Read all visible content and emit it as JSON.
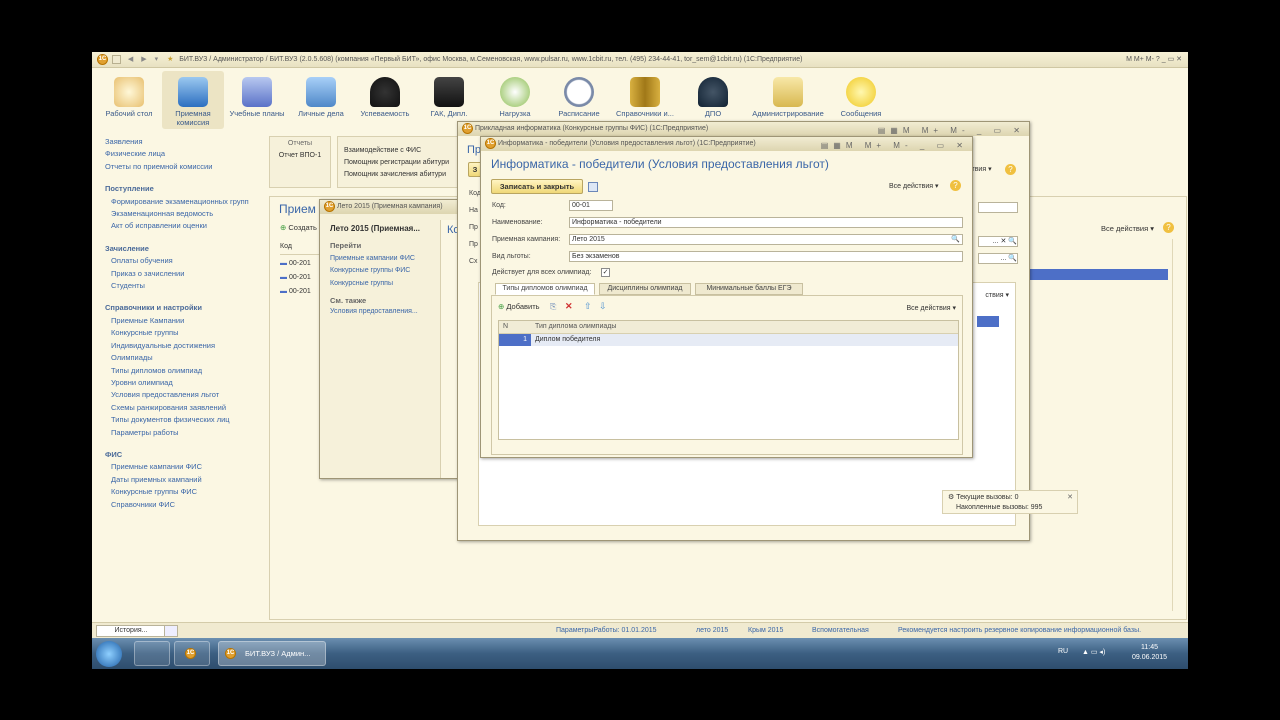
{
  "app": {
    "title": "БИТ.ВУЗ / Администратор / БИТ.ВУЗ (2.0.5.608) (компания «Первый БИТ», офис Москва, м.Семеновская, www.pulsar.ru, www.1cbit.ru, тел. (495) 234-44-41, tor_sem@1cbit.ru)  (1С:Предприятие)",
    "title_buttons": "M  M+  M-"
  },
  "toolbar": {
    "items": [
      {
        "label": "Рабочий стол",
        "icon": "desktop-icon"
      },
      {
        "label": "Приемная комиссия",
        "icon": "building-icon"
      },
      {
        "label": "Учебные планы",
        "icon": "planner-icon"
      },
      {
        "label": "Личные дела",
        "icon": "folder-icon"
      },
      {
        "label": "Успеваемость",
        "icon": "person-icon"
      },
      {
        "label": "ГАК, Дипл.",
        "icon": "graduation-cap-icon"
      },
      {
        "label": "Нагрузка",
        "icon": "globe-icon"
      },
      {
        "label": "Расписание",
        "icon": "clock-icon"
      },
      {
        "label": "Справочники и...",
        "icon": "books-icon"
      },
      {
        "label": "ДПО",
        "icon": "graduate-icon"
      },
      {
        "label": "Администрирование",
        "icon": "admin-icon"
      },
      {
        "label": "Сообщения",
        "icon": "message-icon"
      }
    ]
  },
  "leftnav": {
    "top": [
      "Заявления",
      "Физические лица",
      "Отчеты по приемной комиссии"
    ],
    "groups": [
      {
        "title": "Поступление",
        "items": [
          "Формирование экзаменационных групп",
          "Экзаменационная ведомость",
          "Акт об исправлении оценки"
        ]
      },
      {
        "title": "Зачисление",
        "items": [
          "Оплаты обучения",
          "Приказ о зачислении",
          "Студенты"
        ]
      },
      {
        "title": "Справочники и настройки",
        "items": [
          "Приемные Кампании",
          "Конкурсные группы",
          "Индивидуальные достижения",
          "Олимпиады",
          "Типы дипломов олимпиад",
          "Уровни олимпиад",
          "Условия предоставления льгот",
          "Схемы ранжирования заявлений",
          "Типы документов физических лиц",
          "Параметры работы"
        ]
      },
      {
        "title": "ФИС",
        "items": [
          "Приемные кампании ФИС",
          "Даты приемных кампаний",
          "Конкурсные группы ФИС",
          "Справочники ФИС"
        ]
      }
    ]
  },
  "background": {
    "reports_label": "Отчеты",
    "report_item": "Отчет ВПО-1",
    "fis_items": [
      "Взаимодействие с ФИС",
      "Помощник регистрации абитури",
      "Помощник зачисления абитури"
    ],
    "list_title": "Прием",
    "create_btn": "Создать",
    "col_code": "Код",
    "rows": [
      "00-201",
      "00-201",
      "00-201"
    ],
    "all_actions": "Все действия"
  },
  "leto_window": {
    "title": "Лето 2015 (Приемная кампания)",
    "header": "Лето 2015 (Приемная...",
    "goto": "Перейти",
    "goto_items": [
      "Приемные кампании ФИС",
      "Конкурсные группы ФИС",
      "Конкурсные группы"
    ],
    "see_also": "См. также",
    "see_also_items": [
      "Условия предоставления..."
    ]
  },
  "app_info_window": {
    "title": "Прикладная информатика (Конкурсные группы ФИС)  (1С:Предприятие)",
    "fields": [
      "Код",
      "На",
      "Пр",
      "Пр",
      "Сх"
    ]
  },
  "dialog": {
    "window_title": "Информатика - победители (Условия предоставления льгот)  (1С:Предприятие)",
    "heading": "Информатика - победители (Условия предоставления льгот)",
    "save_button": "Записать и закрыть",
    "all_actions": "Все действия",
    "form": {
      "code_label": "Код:",
      "code_value": "00-01",
      "name_label": "Наименование:",
      "name_value": "Информатика - победители",
      "campaign_label": "Приемная кампания:",
      "campaign_value": "Лето 2015",
      "benefit_label": "Вид льготы:",
      "benefit_value": "Без экзаменов",
      "all_olympiads_label": "Действует для всех олимпиад:",
      "all_olympiads_checked": true
    },
    "tabs": [
      "Типы дипломов олимпиад",
      "Дисциплины олимпиад",
      "Минимальные баллы ЕГЭ"
    ],
    "add_button": "Добавить",
    "table": {
      "columns": [
        "N",
        "Тип диплома олимпиады"
      ],
      "rows": [
        {
          "n": "1",
          "type": "Диплом победителя"
        }
      ]
    }
  },
  "calls_popup": {
    "current": "Текущие вызовы: 0",
    "accumulated": "Накопленные вызовы: 995"
  },
  "statusbar": {
    "history": "История...",
    "items": [
      "ПараметрыРаботы: 01.01.2015",
      "лето 2015",
      "Крым 2015",
      "Вспомогательная",
      "Рекомендуется настроить резервное копирование информационной базы."
    ]
  },
  "taskbar": {
    "active_app": "БИТ.ВУЗ / Админ...",
    "lang": "RU",
    "time": "11:45",
    "date": "09.06.2015"
  },
  "colors": {
    "accent": "#3a66a8",
    "background": "#fbf7e3",
    "selection": "#4d6fc7",
    "button": "#f0d878"
  }
}
